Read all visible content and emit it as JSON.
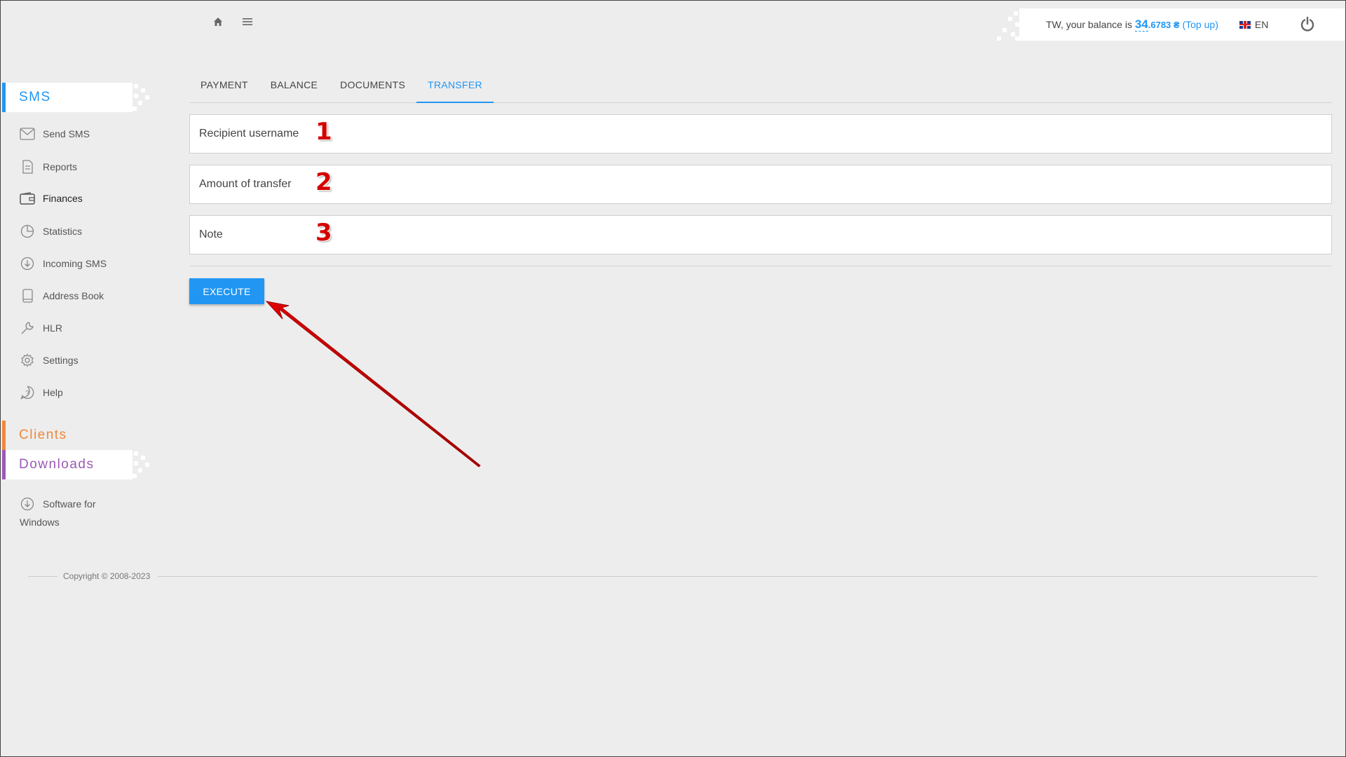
{
  "header": {
    "home_icon": "home-icon",
    "menu_icon": "hamburger-menu-icon",
    "balance_prefix": "TW, your balance is ",
    "balance_int": "34",
    "balance_dec": ".6783 ₴",
    "topup_open": " (",
    "topup_label": "Top up",
    "topup_close": ")",
    "language": "EN",
    "power_icon": "power-icon"
  },
  "sidebar": {
    "sms_section": "SMS",
    "items": [
      {
        "label": "Send SMS",
        "icon": "envelope-icon"
      },
      {
        "label": "Reports",
        "icon": "document-icon"
      },
      {
        "label": "Finances",
        "icon": "wallet-icon"
      },
      {
        "label": "Statistics",
        "icon": "pie-chart-icon"
      },
      {
        "label": "Incoming SMS",
        "icon": "download-circle-icon"
      },
      {
        "label": "Address Book",
        "icon": "book-icon"
      },
      {
        "label": "HLR",
        "icon": "wrench-icon"
      },
      {
        "label": "Settings",
        "icon": "gear-icon"
      },
      {
        "label": "Help",
        "icon": "help-icon"
      }
    ],
    "clients_section": "Clients",
    "downloads_section": "Downloads",
    "software_line1": "Software for",
    "software_line2": "Windows"
  },
  "tabs": [
    {
      "label": "PAYMENT",
      "active": false
    },
    {
      "label": "BALANCE",
      "active": false
    },
    {
      "label": "DOCUMENTS",
      "active": false
    },
    {
      "label": "TRANSFER",
      "active": true
    }
  ],
  "form": {
    "recipient_label": "Recipient username",
    "recipient_value": "",
    "amount_label": "Amount of transfer",
    "amount_value": "",
    "note_label": "Note",
    "note_value": "",
    "execute_label": "EXECUTE"
  },
  "annotations": {
    "marker_1": "1",
    "marker_2": "2",
    "marker_3": "3",
    "arrow_color": "#cc0000"
  },
  "footer": {
    "copyright": "Copyright © 2008-2023"
  },
  "colors": {
    "accent": "#2196f3",
    "sms": "#2196f3",
    "clients": "#f0873a",
    "downloads": "#9b59b6"
  }
}
